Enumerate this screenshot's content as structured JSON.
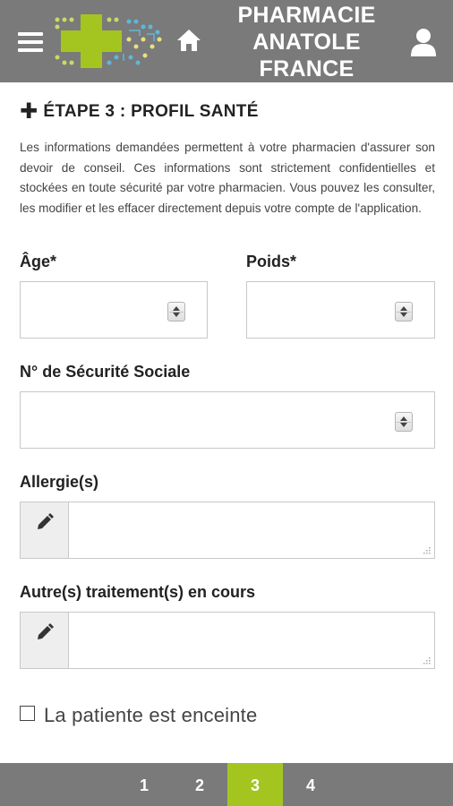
{
  "header": {
    "title_lines": [
      "PHARMACIE",
      "ANATOLE",
      "FRANCE"
    ],
    "background": "#7a7a7a",
    "menu_icon": "hamburger-menu-icon",
    "home_icon": "home-icon",
    "user_icon": "user-icon",
    "logo": "pharmacy-cross-logo"
  },
  "step": {
    "title": "ÉTAPE 3 : PROFIL SANTÉ",
    "icon": "plus-icon",
    "intro": "Les informations demandées permettent à votre pharmacien d'assurer son devoir de conseil. Ces informations sont strictement confidentielles et stockées en toute sécurité par votre pharmacien. Vous pouvez les consulter, les modifier et les effacer directement depuis votre compte de l'application."
  },
  "form": {
    "age": {
      "label": "Âge*",
      "value": ""
    },
    "weight": {
      "label": "Poids*",
      "value": ""
    },
    "social_security": {
      "label": "N° de Sécurité Sociale",
      "value": ""
    },
    "allergies": {
      "label": "Allergie(s)",
      "value": "",
      "icon": "pencil-icon"
    },
    "treatments": {
      "label": "Autre(s) traitement(s) en cours",
      "value": "",
      "icon": "pencil-icon"
    },
    "pregnant": {
      "label": "La patiente est enceinte",
      "checked": false
    }
  },
  "pager": {
    "pages": [
      "1",
      "2",
      "3",
      "4"
    ],
    "active": "3",
    "accent": "#a4c520"
  }
}
